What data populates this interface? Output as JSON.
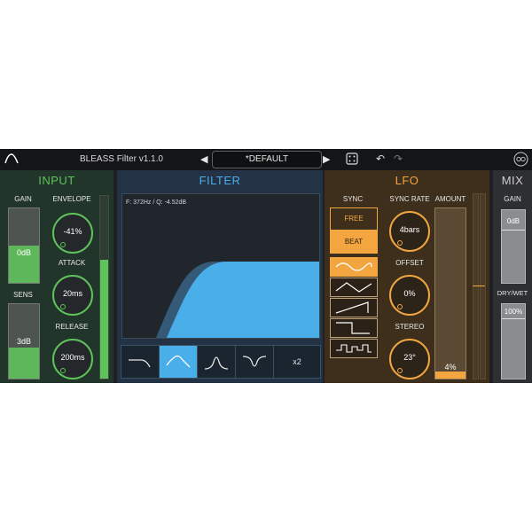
{
  "header": {
    "title": "BLEASS Filter  v1.1.0",
    "preset_name": "*DEFAULT",
    "prev_arrow": "◀",
    "next_arrow": "▶",
    "dice_icon": "dice-icon",
    "undo_icon": "↶",
    "redo_icon": "↷"
  },
  "input": {
    "title": "INPUT",
    "gain_label": "GAIN",
    "gain_value": "0dB",
    "gain_level": 0.5,
    "sens_label": "SENS",
    "sens_value": "3dB",
    "sens_level": 0.42,
    "envelope_label": "ENVELOPE",
    "envelope_value": "-41%",
    "attack_label": "ATTACK",
    "attack_value": "20ms",
    "release_label": "RELEASE",
    "release_value": "200ms",
    "meter_level": 0.65
  },
  "filter": {
    "title": "FILTER",
    "readout": "F: 372Hz / Q: -4.52dB",
    "types": [
      "lowpass",
      "lowpass-resonant",
      "bandpass",
      "notch"
    ],
    "selected_type": 1,
    "multiplier": "x2"
  },
  "lfo": {
    "title": "LFO",
    "sync_label": "SYNC",
    "free_label": "FREE",
    "beat_label": "BEAT",
    "sync_rate_label": "SYNC RATE",
    "sync_rate_value": "4bars",
    "offset_label": "OFFSET",
    "offset_value": "0%",
    "stereo_label": "STEREO",
    "stereo_value": "23°",
    "amount_label": "AMOUNT",
    "amount_value": "4%",
    "waveforms": [
      "sine",
      "triangle",
      "saw",
      "square",
      "random"
    ],
    "selected_waveform": 0
  },
  "mix": {
    "title": "MIX",
    "gain_label": "GAIN",
    "gain_value": "0dB",
    "drywet_label": "DRY/WET",
    "drywet_value": "100%"
  },
  "colors": {
    "input_accent": "#5fc35c",
    "filter_accent": "#4aaee8",
    "lfo_accent": "#f3a640",
    "mix_accent": "#cfcfcf"
  }
}
